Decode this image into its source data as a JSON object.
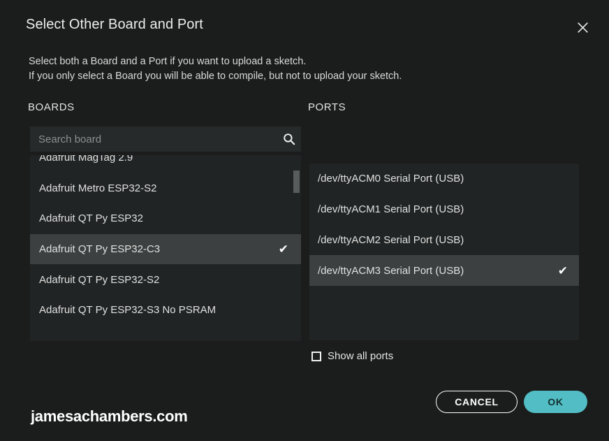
{
  "window": {
    "title": "Select Other Board and Port",
    "close_icon": "close-icon",
    "background_color": "#1b1c1c"
  },
  "description": {
    "line1": "Select both a Board and a Port if you want to upload a sketch.",
    "line2": "If you only select a Board you will be able to compile, but not to upload your sketch."
  },
  "boards": {
    "heading": "BOARDS",
    "search": {
      "placeholder": "Search board",
      "value": "",
      "icon": "search-icon"
    },
    "items": [
      {
        "label": "Adafruit MagTag 2.9",
        "selected": false,
        "partially_visible": true
      },
      {
        "label": "Adafruit Metro ESP32-S2",
        "selected": false
      },
      {
        "label": "Adafruit QT Py ESP32",
        "selected": false
      },
      {
        "label": "Adafruit QT Py ESP32-C3",
        "selected": true
      },
      {
        "label": "Adafruit QT Py ESP32-S2",
        "selected": false
      },
      {
        "label": "Adafruit QT Py ESP32-S3 No PSRAM",
        "selected": false
      }
    ],
    "check_glyph": "✔",
    "selected_row_color": "#3d4040",
    "panel_color": "#212424"
  },
  "ports": {
    "heading": "PORTS",
    "items": [
      {
        "label": "/dev/ttyACM0 Serial Port (USB)",
        "selected": false
      },
      {
        "label": "/dev/ttyACM1 Serial Port (USB)",
        "selected": false
      },
      {
        "label": "/dev/ttyACM2 Serial Port (USB)",
        "selected": false
      },
      {
        "label": "/dev/ttyACM3 Serial Port (USB)",
        "selected": true
      }
    ],
    "check_glyph": "✔",
    "show_all": {
      "label": "Show all ports",
      "checked": false
    }
  },
  "footer": {
    "cancel_label": "CANCEL",
    "ok_label": "OK",
    "ok_color": "#52bdc4"
  },
  "watermark": {
    "text": "jamesachambers.com"
  }
}
